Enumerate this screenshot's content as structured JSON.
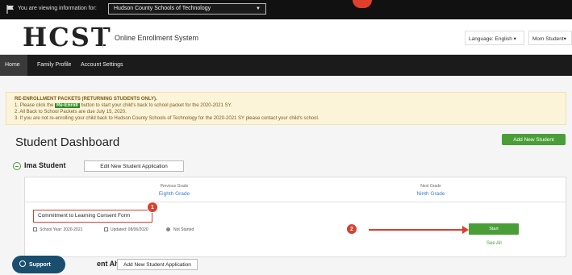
{
  "topbar": {
    "viewing_label": "You are viewing information for:",
    "school": "Hudson County Schools of Technology"
  },
  "header": {
    "logo": "HCST",
    "app_title": "Online Enrollment System",
    "language": "Language: English",
    "user": "Mom Student"
  },
  "nav": {
    "items": [
      {
        "label": "Home"
      },
      {
        "label": "Family Profile"
      },
      {
        "label": "Account Settings"
      }
    ]
  },
  "notice": {
    "heading": "RE-ENROLLMENT PACKETS (RETURNING STUDENTS ONLY).",
    "line1_prefix": "1. Please click the",
    "line1_button": "Re-Enroll",
    "line1_suffix": "button to start your child's back to school packet for the 2020-2021 SY.",
    "line2": "2. All Back to School Packets are due July 15, 2020.",
    "line3": "3. If you are not re-enrolling your child back to Hudson County Schools of Technology for the 2020-2021 SY please contact your child's school."
  },
  "dashboard": {
    "title": "Student Dashboard",
    "add_student": "Add New Student"
  },
  "student1": {
    "name": "Ima Student",
    "edit_button": "Edit New Student Application",
    "previous_grade_label": "Previous Grade",
    "previous_grade": "Eighth Grade",
    "next_grade_label": "Next Grade",
    "next_grade": "Ninth Grade",
    "form_name": "Commitment to Learning Consent Form",
    "school_year": "School Year: 2020-2021",
    "updated": "Updated: 08/06/2020",
    "status": "Not Started",
    "start": "Start",
    "see_all": "See All"
  },
  "student2": {
    "name_fragment": "ent Ahmad",
    "add_button": "Add New Student Application"
  },
  "support": {
    "label": "Support"
  },
  "markers": {
    "one": "1",
    "two": "2"
  },
  "colors": {
    "accent_green": "#4a9e38",
    "annotation_red": "#d9402e",
    "link_blue": "#3b7dc4",
    "support_blue": "#1a4e6e"
  }
}
